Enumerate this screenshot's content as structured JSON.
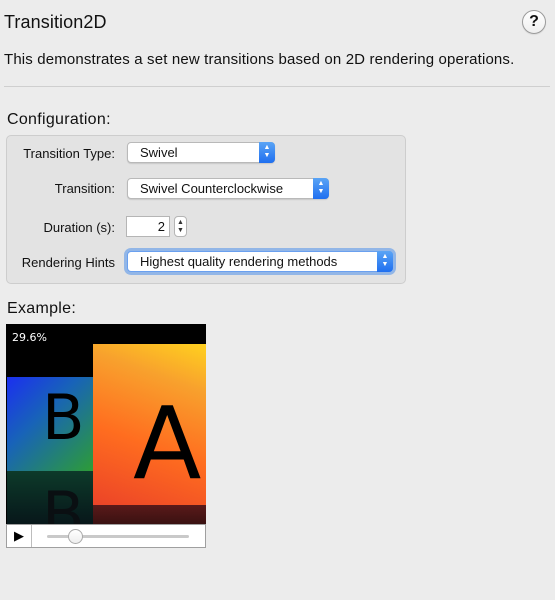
{
  "header": {
    "title": "Transition2D",
    "help_glyph": "?"
  },
  "description": "This demonstrates a set new transitions based on 2D rendering operations.",
  "configuration": {
    "label": "Configuration:",
    "transition_type": {
      "label": "Transition Type:",
      "value": "Swivel"
    },
    "transition": {
      "label": "Transition:",
      "value": "Swivel Counterclockwise"
    },
    "duration": {
      "label": "Duration (s):",
      "value": "2"
    },
    "rendering_hints": {
      "label": "Rendering Hints",
      "value": "Highest quality rendering methods"
    }
  },
  "example": {
    "label": "Example:",
    "progress_text": "29.6%",
    "tile_b_letter": "B",
    "tile_a_letter": "A",
    "play_glyph": "▶",
    "slider_fraction": 0.2
  },
  "colors": {
    "accent": "#1f6ff0",
    "window_bg": "#ececec"
  },
  "icons": {
    "popup_arrows": "up-down-chevron-icon",
    "play": "play-icon",
    "help": "help-icon"
  }
}
